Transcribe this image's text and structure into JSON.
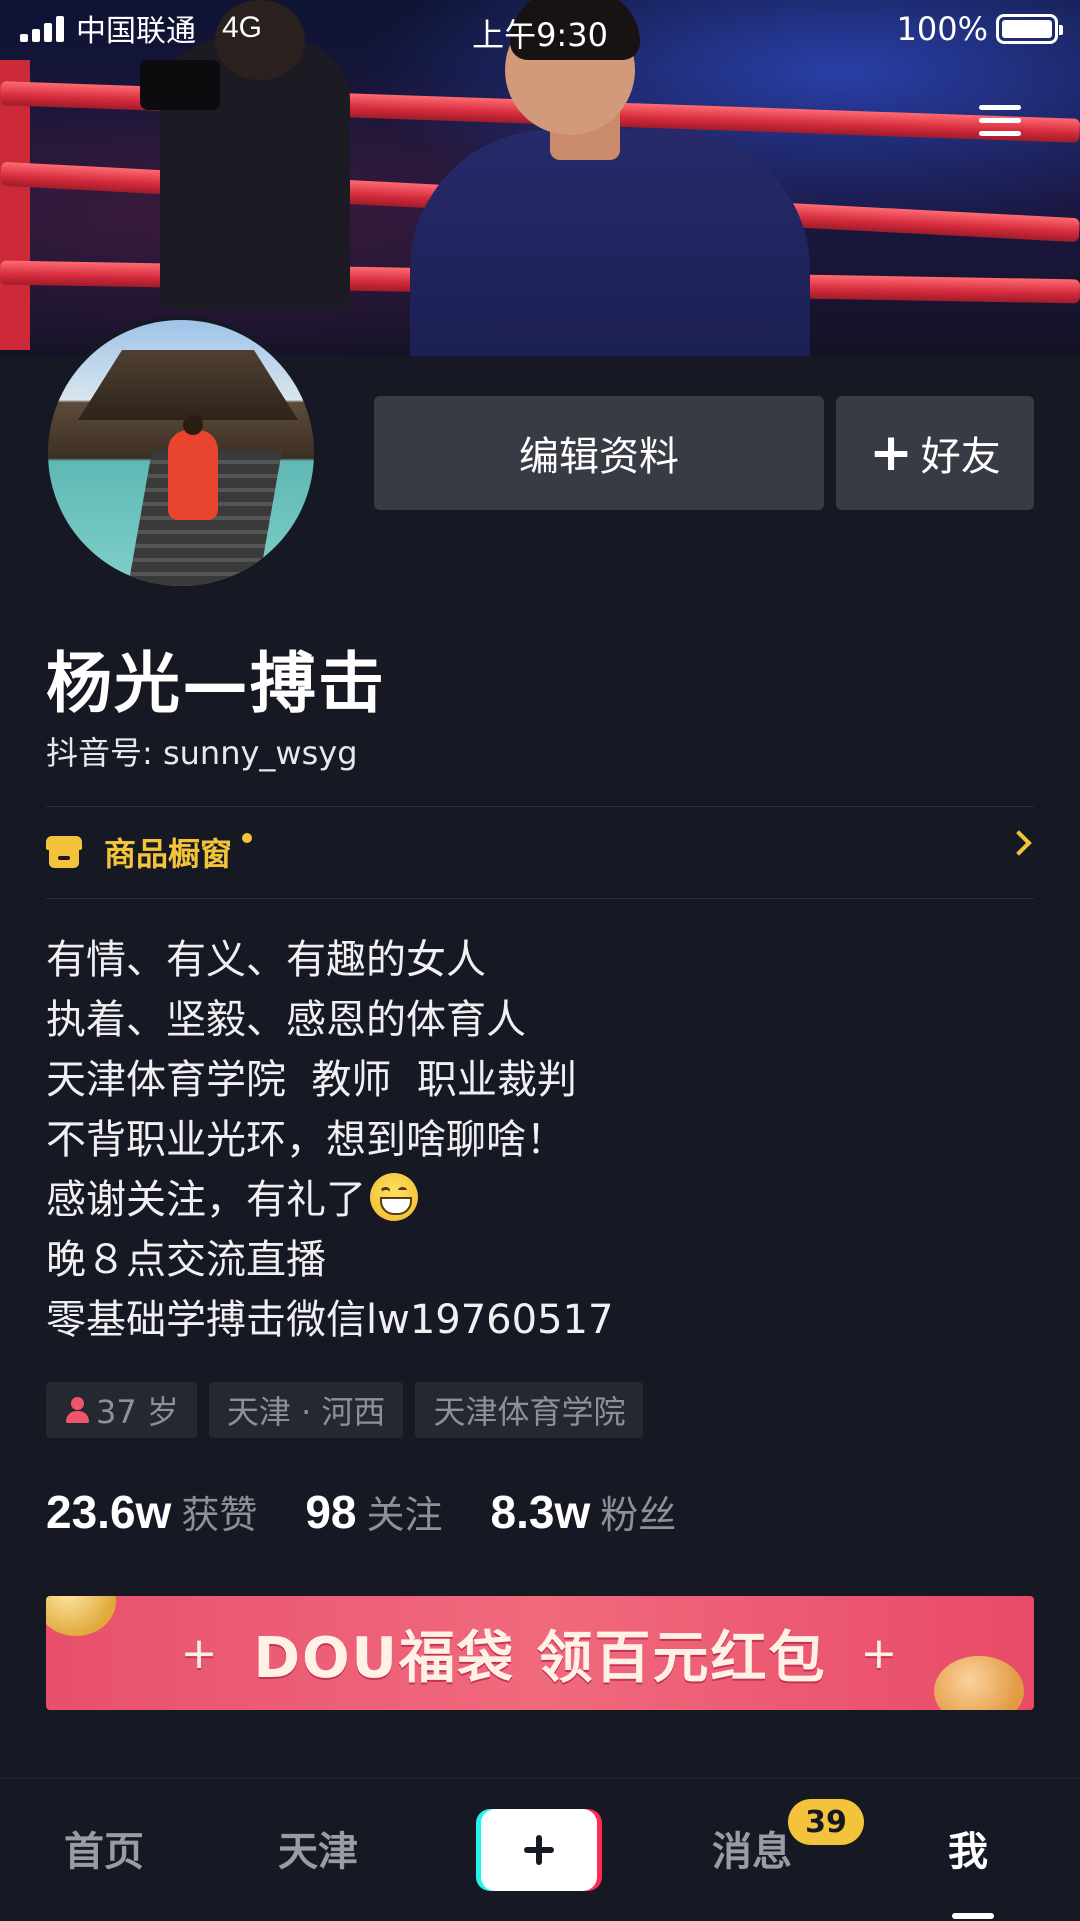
{
  "status_bar": {
    "carrier": "中国联通",
    "network": "4G",
    "time": "上午9:30",
    "battery": "100%"
  },
  "profile": {
    "edit_label": "编辑资料",
    "add_friend_label": "好友",
    "add_friend_icon": "+",
    "name": "杨光—搏击",
    "douyin_id": "抖音号: sunny_wsyg",
    "shop_label": "商品橱窗",
    "bio": [
      "有情、有义、有趣的女人",
      "执着、坚毅、感恩的体育人",
      "天津体育学院  教师  职业裁判",
      "不背职业光环，想到啥聊啥！",
      "感谢关注，有礼了",
      "晚８点交流直播",
      "零基础学搏击微信lw19760517"
    ],
    "tags": {
      "age": "37 岁",
      "location": "天津 · 河西",
      "school": "天津体育学院"
    },
    "stats": [
      {
        "value": "23.6w",
        "label": "获赞"
      },
      {
        "value": "98",
        "label": "关注"
      },
      {
        "value": "8.3w",
        "label": "粉丝"
      }
    ]
  },
  "banner": {
    "text": "DOU福袋  领百元红包",
    "sparkle": "+"
  },
  "tabbar": {
    "home": "首页",
    "city": "天津",
    "messages": "消息",
    "message_badge": "39",
    "me": "我"
  },
  "colors": {
    "background": "#161823",
    "accent_yellow": "#f3c33c",
    "button_gray": "#393b44",
    "banner_pink": "#e8506c"
  },
  "icons": {
    "menu": "hamburger-menu-icon",
    "shop": "storefront-icon",
    "chevron": "chevron-right-icon",
    "age": "person-icon",
    "publish": "plus-icon",
    "emoji": "grinning-face-emoji"
  }
}
